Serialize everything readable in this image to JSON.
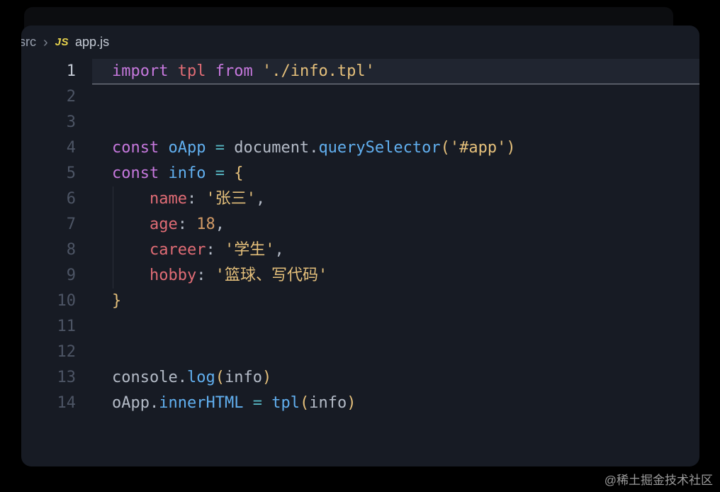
{
  "window": {
    "breadcrumb": {
      "folder": "src",
      "separator": "›",
      "file_icon_label": "JS",
      "file_name": "app.js"
    }
  },
  "colors": {
    "kw": "#c678dd",
    "blue": "#61afef",
    "red": "#e06c75",
    "str": "#e5c07b",
    "num": "#d19a66",
    "op": "#56b6c2",
    "brk": "#e5c07b",
    "fg": "#b4bbc7",
    "js_icon": "#e8d44d",
    "editor_bg": "#171b24"
  },
  "editor": {
    "lines": [
      {
        "n": "1",
        "active": true,
        "tokens": [
          {
            "c": "kw",
            "t": "import"
          },
          {
            "c": "fg",
            "t": " "
          },
          {
            "c": "red",
            "t": "tpl"
          },
          {
            "c": "fg",
            "t": " "
          },
          {
            "c": "kw",
            "t": "from"
          },
          {
            "c": "fg",
            "t": " "
          },
          {
            "c": "str",
            "t": "'./info.tpl'"
          }
        ]
      },
      {
        "n": "2",
        "tokens": []
      },
      {
        "n": "3",
        "tokens": []
      },
      {
        "n": "4",
        "tokens": [
          {
            "c": "kw",
            "t": "const"
          },
          {
            "c": "fg",
            "t": " "
          },
          {
            "c": "blue",
            "t": "oApp"
          },
          {
            "c": "fg",
            "t": " "
          },
          {
            "c": "op",
            "t": "="
          },
          {
            "c": "fg",
            "t": " "
          },
          {
            "c": "fg",
            "t": "document"
          },
          {
            "c": "fg",
            "t": "."
          },
          {
            "c": "blue",
            "t": "querySelector"
          },
          {
            "c": "brk",
            "t": "("
          },
          {
            "c": "str",
            "t": "'#app'"
          },
          {
            "c": "brk",
            "t": ")"
          }
        ]
      },
      {
        "n": "5",
        "tokens": [
          {
            "c": "kw",
            "t": "const"
          },
          {
            "c": "fg",
            "t": " "
          },
          {
            "c": "blue",
            "t": "info"
          },
          {
            "c": "fg",
            "t": " "
          },
          {
            "c": "op",
            "t": "="
          },
          {
            "c": "fg",
            "t": " "
          },
          {
            "c": "brk",
            "t": "{"
          }
        ]
      },
      {
        "n": "6",
        "guide": true,
        "tokens": [
          {
            "c": "fg",
            "t": "    "
          },
          {
            "c": "red",
            "t": "name"
          },
          {
            "c": "fg",
            "t": ": "
          },
          {
            "c": "str",
            "t": "'张三'"
          },
          {
            "c": "fg",
            "t": ","
          }
        ]
      },
      {
        "n": "7",
        "guide": true,
        "tokens": [
          {
            "c": "fg",
            "t": "    "
          },
          {
            "c": "red",
            "t": "age"
          },
          {
            "c": "fg",
            "t": ": "
          },
          {
            "c": "num",
            "t": "18"
          },
          {
            "c": "fg",
            "t": ","
          }
        ]
      },
      {
        "n": "8",
        "guide": true,
        "tokens": [
          {
            "c": "fg",
            "t": "    "
          },
          {
            "c": "red",
            "t": "career"
          },
          {
            "c": "fg",
            "t": ": "
          },
          {
            "c": "str",
            "t": "'学生'"
          },
          {
            "c": "fg",
            "t": ","
          }
        ]
      },
      {
        "n": "9",
        "guide": true,
        "tokens": [
          {
            "c": "fg",
            "t": "    "
          },
          {
            "c": "red",
            "t": "hobby"
          },
          {
            "c": "fg",
            "t": ": "
          },
          {
            "c": "str",
            "t": "'篮球、写代码'"
          }
        ]
      },
      {
        "n": "10",
        "tokens": [
          {
            "c": "brk",
            "t": "}"
          }
        ]
      },
      {
        "n": "11",
        "tokens": []
      },
      {
        "n": "12",
        "tokens": []
      },
      {
        "n": "13",
        "tokens": [
          {
            "c": "fg",
            "t": "console"
          },
          {
            "c": "fg",
            "t": "."
          },
          {
            "c": "blue",
            "t": "log"
          },
          {
            "c": "brk",
            "t": "("
          },
          {
            "c": "fg",
            "t": "info"
          },
          {
            "c": "brk",
            "t": ")"
          }
        ]
      },
      {
        "n": "14",
        "tokens": [
          {
            "c": "fg",
            "t": "oApp"
          },
          {
            "c": "fg",
            "t": "."
          },
          {
            "c": "blue",
            "t": "innerHTML"
          },
          {
            "c": "fg",
            "t": " "
          },
          {
            "c": "op",
            "t": "="
          },
          {
            "c": "fg",
            "t": " "
          },
          {
            "c": "blue",
            "t": "tpl"
          },
          {
            "c": "brk",
            "t": "("
          },
          {
            "c": "fg",
            "t": "info"
          },
          {
            "c": "brk",
            "t": ")"
          }
        ]
      }
    ]
  },
  "watermark": "@稀土掘金技术社区"
}
